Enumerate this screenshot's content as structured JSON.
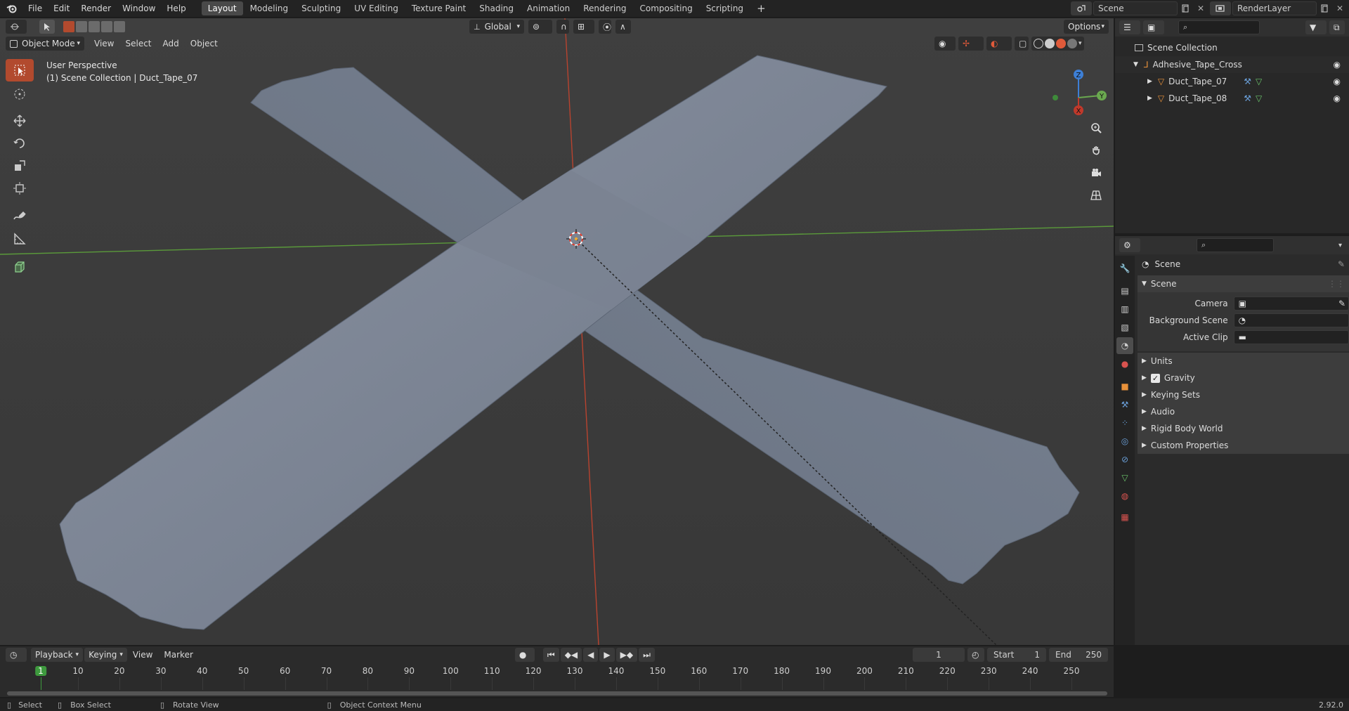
{
  "topbar": {
    "menus": [
      "File",
      "Edit",
      "Render",
      "Window",
      "Help"
    ],
    "workspaces": [
      "Layout",
      "Modeling",
      "Sculpting",
      "UV Editing",
      "Texture Paint",
      "Shading",
      "Animation",
      "Rendering",
      "Compositing",
      "Scripting"
    ],
    "active_workspace": "Layout",
    "add_tab": "+",
    "scene_name": "Scene",
    "view_layer": "RenderLayer"
  },
  "toolheader": {
    "orientation": "Global",
    "options": "Options"
  },
  "viewport_header": {
    "mode": "Object Mode",
    "menus": [
      "View",
      "Select",
      "Add",
      "Object"
    ]
  },
  "viewport": {
    "perspective": "User Perspective",
    "context": "(1) Scene Collection | Duct_Tape_07",
    "gizmo": {
      "x": "X",
      "y": "Y",
      "z": "Z"
    }
  },
  "outliner": {
    "root": "Scene Collection",
    "collection": "Adhesive_Tape_Cross",
    "objects": [
      "Duct_Tape_07",
      "Duct_Tape_08"
    ]
  },
  "properties": {
    "header": "Scene",
    "panel_title": "Scene",
    "fields": [
      {
        "label": "Camera"
      },
      {
        "label": "Background Scene"
      },
      {
        "label": "Active Clip"
      }
    ],
    "subpanels": [
      "Units",
      "Gravity",
      "Keying Sets",
      "Audio",
      "Rigid Body World",
      "Custom Properties"
    ],
    "gravity_checked": true
  },
  "timeline": {
    "menus": [
      "Playback",
      "Keying",
      "View",
      "Marker"
    ],
    "current_frame": "1",
    "start_label": "Start",
    "start": "1",
    "end_label": "End",
    "end": "250",
    "ticks": [
      "1",
      "10",
      "20",
      "30",
      "40",
      "50",
      "60",
      "70",
      "80",
      "90",
      "100",
      "110",
      "120",
      "130",
      "140",
      "150",
      "160",
      "170",
      "180",
      "190",
      "200",
      "210",
      "220",
      "230",
      "240",
      "250"
    ]
  },
  "statusbar": {
    "select": "Select",
    "box_select": "Box Select",
    "rotate": "Rotate View",
    "context_menu": "Object Context Menu",
    "version": "2.92.0"
  },
  "colors": {
    "accent": "#b24a2e",
    "x_axis": "#c0392b",
    "y_axis": "#6aa84f",
    "z_axis": "#3d7fd6",
    "tape": "#7d8696"
  }
}
